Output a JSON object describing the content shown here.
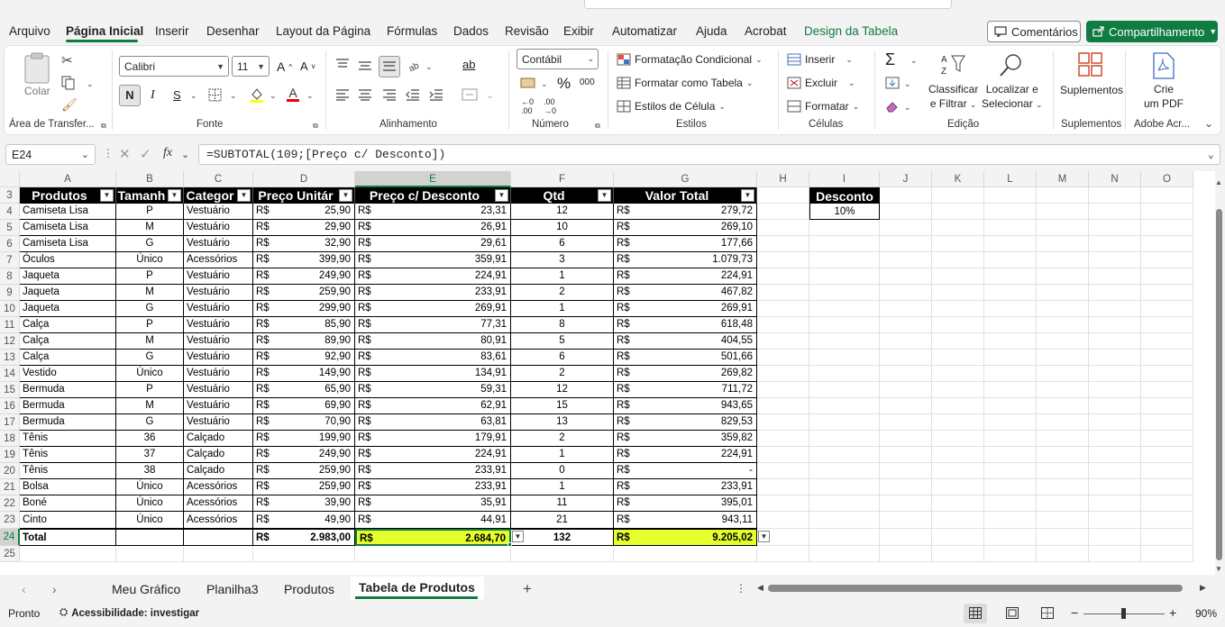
{
  "menu": {
    "items": [
      "Arquivo",
      "Página Inicial",
      "Inserir",
      "Desenhar",
      "Layout da Página",
      "Fórmulas",
      "Dados",
      "Revisão",
      "Exibir",
      "Automatizar",
      "Ajuda",
      "Acrobat",
      "Design da Tabela"
    ],
    "active": "Página Inicial",
    "comments": "Comentários",
    "share": "Compartilhamento"
  },
  "ribbon": {
    "clipboard": {
      "paste": "Colar",
      "label": "Área de Transfer..."
    },
    "font": {
      "name": "Calibri",
      "size": "11",
      "bold": "N",
      "italic": "I",
      "underline": "S",
      "label": "Fonte"
    },
    "alignment": {
      "label": "Alinhamento"
    },
    "number": {
      "format": "Contábil",
      "label": "Número",
      "thousands": "000"
    },
    "styles": {
      "conditional": "Formatação Condicional",
      "as_table": "Formatar como Tabela",
      "cell_styles": "Estilos de Célula",
      "label": "Estilos"
    },
    "cells": {
      "insert": "Inserir",
      "delete": "Excluir",
      "format": "Formatar",
      "label": "Células"
    },
    "editing": {
      "sort_l1": "Classificar",
      "sort_l2": "e Filtrar",
      "find_l1": "Localizar e",
      "find_l2": "Selecionar",
      "label": "Edição"
    },
    "addins": {
      "btn": "Suplementos",
      "label": "Suplementos"
    },
    "acrobat": {
      "l1": "Crie",
      "l2": "um PDF",
      "label": "Adobe Acr..."
    }
  },
  "formula_bar": {
    "name_box": "E24",
    "fx": "fx",
    "formula": "=SUBTOTAL(109;[Preço c/ Desconto])"
  },
  "columns": [
    "A",
    "B",
    "C",
    "D",
    "E",
    "F",
    "G",
    "H",
    "I",
    "J",
    "K",
    "L",
    "M",
    "N",
    "O"
  ],
  "table": {
    "headers": [
      "Produtos",
      "Tamanh",
      "Categor",
      "Preço Unitár",
      "Preço c/ Desconto",
      "Qtd",
      "Valor Total"
    ],
    "currency": "R$",
    "rows": [
      {
        "n": "4",
        "prod": "Camiseta Lisa",
        "tam": "P",
        "cat": "Vestuário",
        "pu": "25,90",
        "pd": "23,31",
        "qtd": "12",
        "vt": "279,72"
      },
      {
        "n": "5",
        "prod": "Camiseta Lisa",
        "tam": "M",
        "cat": "Vestuário",
        "pu": "29,90",
        "pd": "26,91",
        "qtd": "10",
        "vt": "269,10"
      },
      {
        "n": "6",
        "prod": "Camiseta Lisa",
        "tam": "G",
        "cat": "Vestuário",
        "pu": "32,90",
        "pd": "29,61",
        "qtd": "6",
        "vt": "177,66"
      },
      {
        "n": "7",
        "prod": "Óculos",
        "tam": "Único",
        "cat": "Acessórios",
        "pu": "399,90",
        "pd": "359,91",
        "qtd": "3",
        "vt": "1.079,73"
      },
      {
        "n": "8",
        "prod": "Jaqueta",
        "tam": "P",
        "cat": "Vestuário",
        "pu": "249,90",
        "pd": "224,91",
        "qtd": "1",
        "vt": "224,91"
      },
      {
        "n": "9",
        "prod": "Jaqueta",
        "tam": "M",
        "cat": "Vestuário",
        "pu": "259,90",
        "pd": "233,91",
        "qtd": "2",
        "vt": "467,82"
      },
      {
        "n": "10",
        "prod": "Jaqueta",
        "tam": "G",
        "cat": "Vestuário",
        "pu": "299,90",
        "pd": "269,91",
        "qtd": "1",
        "vt": "269,91"
      },
      {
        "n": "11",
        "prod": "Calça",
        "tam": "P",
        "cat": "Vestuário",
        "pu": "85,90",
        "pd": "77,31",
        "qtd": "8",
        "vt": "618,48"
      },
      {
        "n": "12",
        "prod": "Calça",
        "tam": "M",
        "cat": "Vestuário",
        "pu": "89,90",
        "pd": "80,91",
        "qtd": "5",
        "vt": "404,55"
      },
      {
        "n": "13",
        "prod": "Calça",
        "tam": "G",
        "cat": "Vestuário",
        "pu": "92,90",
        "pd": "83,61",
        "qtd": "6",
        "vt": "501,66"
      },
      {
        "n": "14",
        "prod": "Vestido",
        "tam": "Único",
        "cat": "Vestuário",
        "pu": "149,90",
        "pd": "134,91",
        "qtd": "2",
        "vt": "269,82"
      },
      {
        "n": "15",
        "prod": "Bermuda",
        "tam": "P",
        "cat": "Vestuário",
        "pu": "65,90",
        "pd": "59,31",
        "qtd": "12",
        "vt": "711,72"
      },
      {
        "n": "16",
        "prod": "Bermuda",
        "tam": "M",
        "cat": "Vestuário",
        "pu": "69,90",
        "pd": "62,91",
        "qtd": "15",
        "vt": "943,65"
      },
      {
        "n": "17",
        "prod": "Bermuda",
        "tam": "G",
        "cat": "Vestuário",
        "pu": "70,90",
        "pd": "63,81",
        "qtd": "13",
        "vt": "829,53"
      },
      {
        "n": "18",
        "prod": "Tênis",
        "tam": "36",
        "cat": "Calçado",
        "pu": "199,90",
        "pd": "179,91",
        "qtd": "2",
        "vt": "359,82"
      },
      {
        "n": "19",
        "prod": "Tênis",
        "tam": "37",
        "cat": "Calçado",
        "pu": "249,90",
        "pd": "224,91",
        "qtd": "1",
        "vt": "224,91"
      },
      {
        "n": "20",
        "prod": "Tênis",
        "tam": "38",
        "cat": "Calçado",
        "pu": "259,90",
        "pd": "233,91",
        "qtd": "0",
        "vt": "-"
      },
      {
        "n": "21",
        "prod": "Bolsa",
        "tam": "Único",
        "cat": "Acessórios",
        "pu": "259,90",
        "pd": "233,91",
        "qtd": "1",
        "vt": "233,91"
      },
      {
        "n": "22",
        "prod": "Boné",
        "tam": "Único",
        "cat": "Acessórios",
        "pu": "39,90",
        "pd": "35,91",
        "qtd": "11",
        "vt": "395,01"
      },
      {
        "n": "23",
        "prod": "Cinto",
        "tam": "Único",
        "cat": "Acessórios",
        "pu": "49,90",
        "pd": "44,91",
        "qtd": "21",
        "vt": "943,11"
      }
    ],
    "total": {
      "n": "24",
      "label": "Total",
      "pu": "2.983,00",
      "pd": "2.684,70",
      "qtd": "132",
      "vt": "9.205,02"
    },
    "highlight_color": "#e5ff2d"
  },
  "discount": {
    "label": "Desconto",
    "value": "10%"
  },
  "sheets": {
    "tabs": [
      "Meu Gráfico",
      "Planilha3",
      "Produtos",
      "Tabela de Produtos"
    ],
    "active": "Tabela de Produtos"
  },
  "status": {
    "ready": "Pronto",
    "accessibility": "Acessibilidade: investigar",
    "zoom": "90%"
  }
}
